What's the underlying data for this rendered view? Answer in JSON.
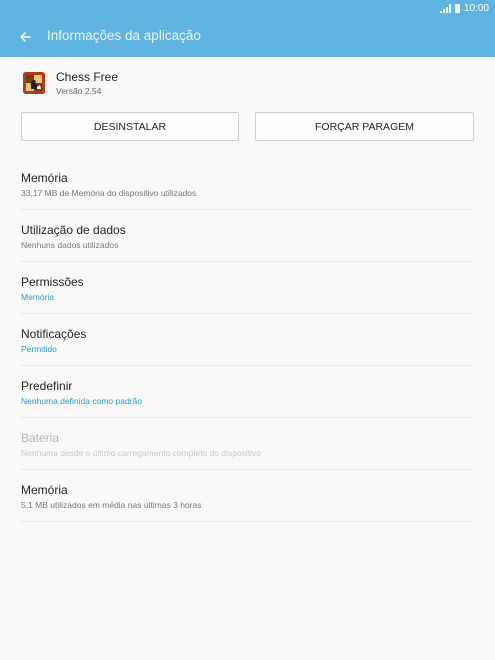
{
  "status_bar": {
    "time": "10:00"
  },
  "app_bar": {
    "title": "Informações da aplicação"
  },
  "app": {
    "name": "Chess Free",
    "version": "Versão 2.54"
  },
  "buttons": {
    "uninstall": "DESINSTALAR",
    "force_stop": "FORÇAR PARAGEM"
  },
  "items": [
    {
      "title": "Memória",
      "subtitle": "33,17 MB de Memória do dispositivo utilizados"
    },
    {
      "title": "Utilização de dados",
      "subtitle": "Nenhuns dados utilizados"
    },
    {
      "title": "Permissões",
      "subtitle": "Memória"
    },
    {
      "title": "Notificações",
      "subtitle": "Permitido"
    },
    {
      "title": "Predefinir",
      "subtitle": "Nenhuma definida como padrão"
    },
    {
      "title": "Bateria",
      "subtitle": "Nenhuma desde o último carregamento completo do dispositivo"
    },
    {
      "title": "Memória",
      "subtitle": "5,1 MB utilizados em média nas últimas 3 horas"
    }
  ],
  "colors": {
    "accent": "#5fb3e0",
    "link": "#2b9bd0"
  }
}
